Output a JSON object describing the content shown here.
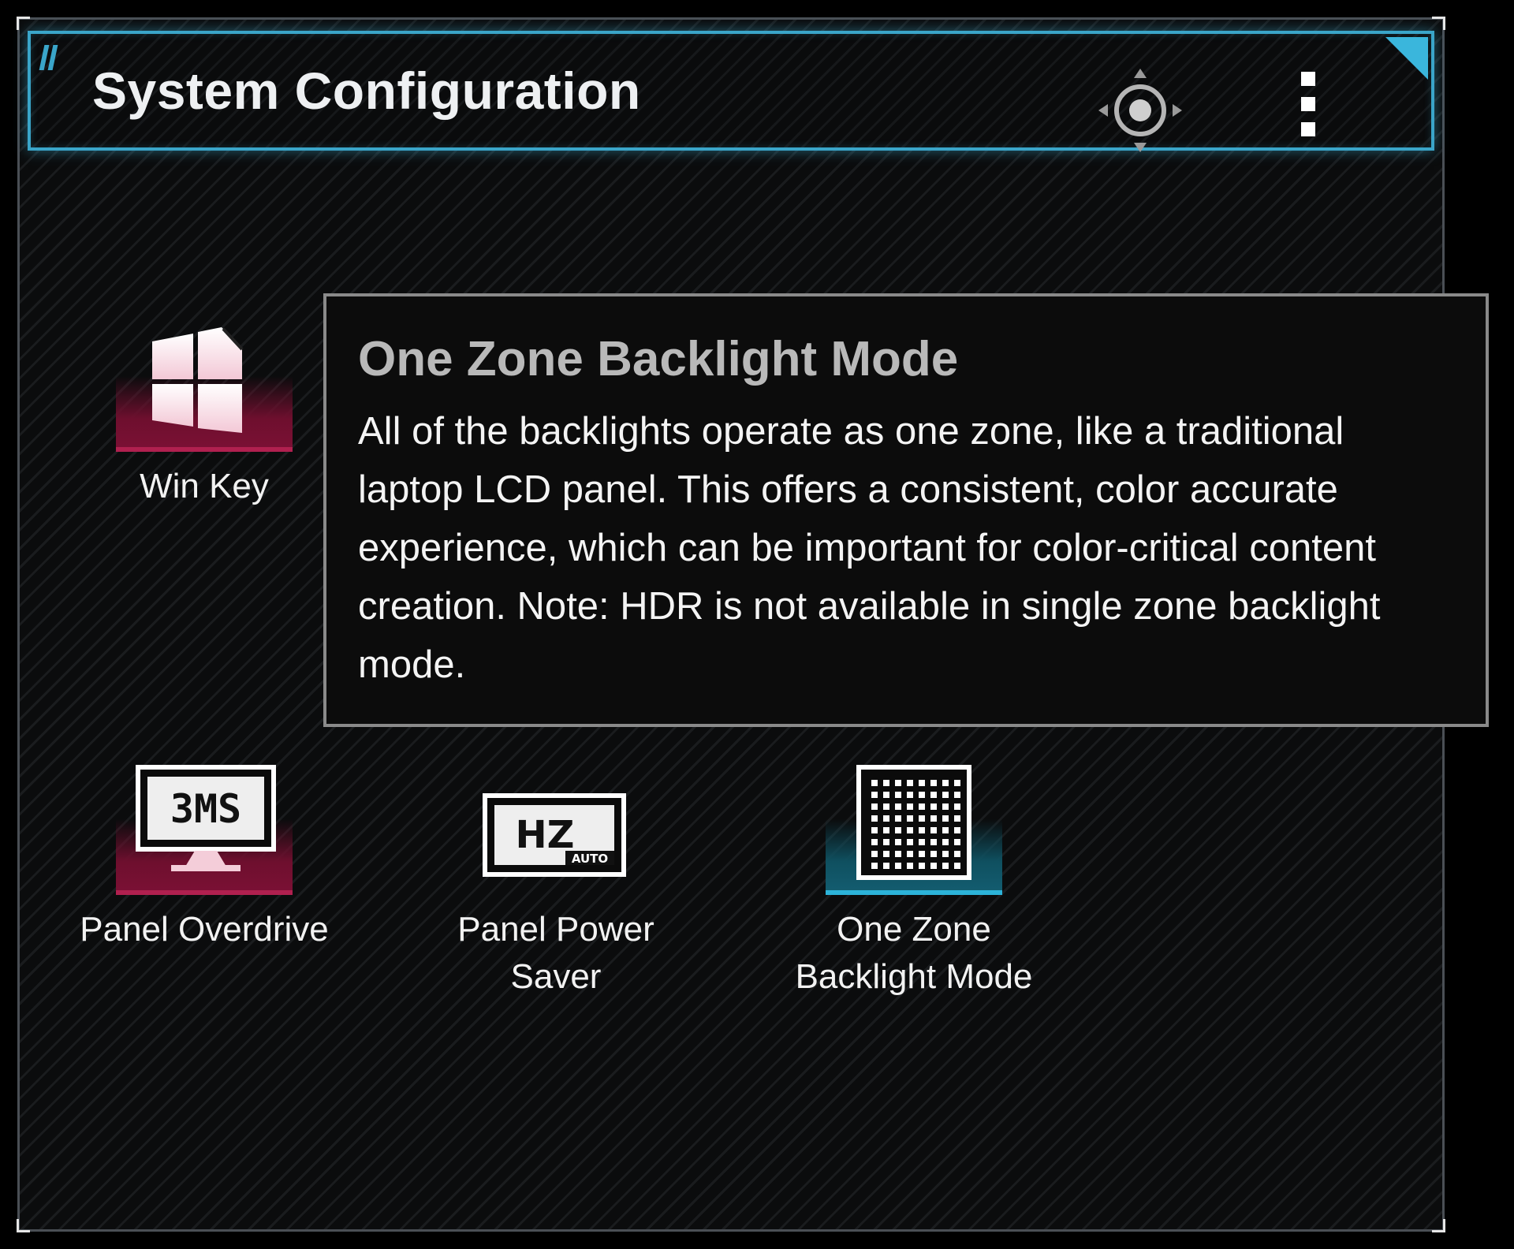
{
  "window": {
    "title": "System Configuration",
    "move_icon": "move-icon",
    "menu_icon": "more-vertical-icon"
  },
  "tiles": [
    {
      "label": "Win Key",
      "icon": "windows-icon",
      "glow_color": "#b0204f",
      "active": true
    },
    {
      "label": "Panel Overdrive",
      "icon": "3ms-monitor-icon",
      "icon_text": "3MS",
      "glow_color": "#b0204f",
      "active": true
    },
    {
      "label": "Panel Power Saver",
      "icon": "hz-auto-icon",
      "icon_text": "HZ",
      "icon_subtext": "AUTO",
      "active": false
    },
    {
      "label": "One Zone\nBacklight Mode",
      "icon": "dot-grid-icon",
      "glow_color": "#2cb3d9",
      "active": true
    }
  ],
  "tooltip": {
    "title": "One Zone Backlight Mode",
    "body": "All of the backlights operate as one zone, like a traditional laptop LCD panel. This offers a consistent, color accurate experience, which can be important for color-critical content creation. Note: HDR is not available in single zone backlight mode."
  },
  "colors": {
    "accent_cyan": "#3aa5c9",
    "accent_red": "#b0204f",
    "background": "#000000"
  }
}
